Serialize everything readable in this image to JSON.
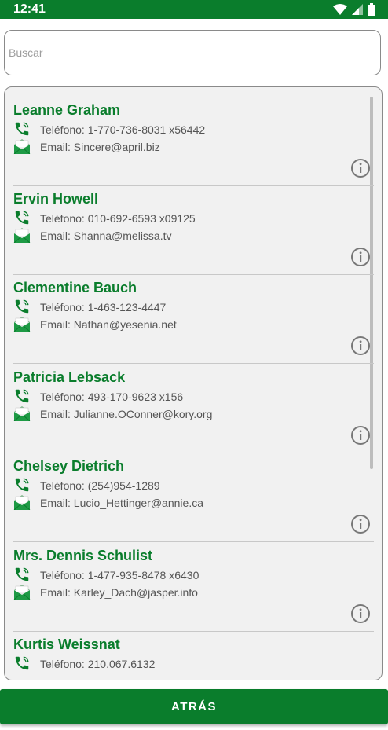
{
  "status_bar": {
    "time": "12:41"
  },
  "search": {
    "placeholder": "Buscar",
    "value": ""
  },
  "contacts": [
    {
      "name": "Leanne Graham",
      "phone": "Teléfono: 1-770-736-8031 x56442",
      "email": "Email: Sincere@april.biz"
    },
    {
      "name": "Ervin Howell",
      "phone": "Teléfono: 010-692-6593 x09125",
      "email": "Email: Shanna@melissa.tv"
    },
    {
      "name": "Clementine Bauch",
      "phone": "Teléfono: 1-463-123-4447",
      "email": "Email: Nathan@yesenia.net"
    },
    {
      "name": "Patricia Lebsack",
      "phone": "Teléfono: 493-170-9623 x156",
      "email": "Email: Julianne.OConner@kory.org"
    },
    {
      "name": "Chelsey Dietrich",
      "phone": "Teléfono: (254)954-1289",
      "email": "Email: Lucio_Hettinger@annie.ca"
    },
    {
      "name": "Mrs. Dennis Schulist",
      "phone": "Teléfono: 1-477-935-8478 x6430",
      "email": "Email: Karley_Dach@jasper.info"
    },
    {
      "name": "Kurtis Weissnat",
      "phone": "Teléfono: 210.067.6132",
      "email": ""
    }
  ],
  "footer": {
    "back_label": "ATRÁS"
  },
  "colors": {
    "accent": "#0a7d2c",
    "panel_bg": "#f1f1f1",
    "text_secondary": "#555555"
  },
  "icons": {
    "phone": "phone-icon",
    "mail": "mail-icon",
    "info": "info-icon"
  }
}
